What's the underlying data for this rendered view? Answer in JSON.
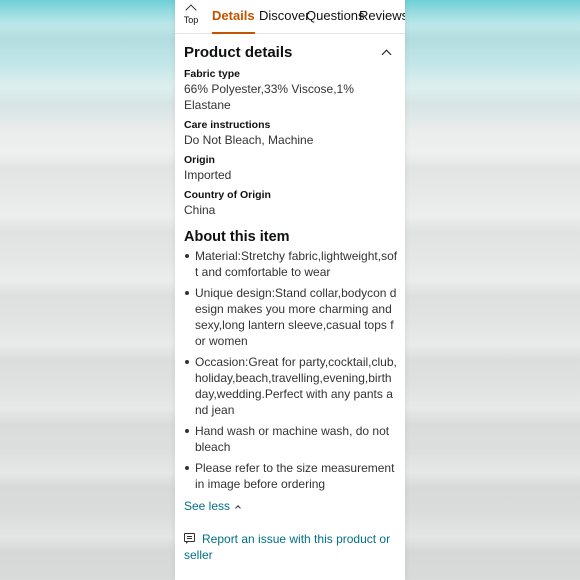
{
  "tabs": {
    "top_label": "Top",
    "details": "Details",
    "discover": "Discover",
    "questions": "Questions",
    "reviews": "Reviews"
  },
  "product_details": {
    "heading": "Product details",
    "items": [
      {
        "label": "Fabric type",
        "value": "66% Polyester,33% Viscose,1% Elastane"
      },
      {
        "label": "Care instructions",
        "value": "Do Not Bleach, Machine"
      },
      {
        "label": "Origin",
        "value": "Imported"
      },
      {
        "label": "Country of Origin",
        "value": "China"
      }
    ]
  },
  "about": {
    "heading": "About this item",
    "bullets": [
      "Material:Stretchy fabric,lightweight,soft and comfortable to wear",
      "Unique design:Stand collar,bodycon design makes you more charming and sexy,long lantern sleeve,casual tops for women",
      "Occasion:Great for party,cocktail,club,holiday,beach,travelling,evening,birthday,wedding.Perfect with any pants and jean",
      "Hand wash or machine wash, do not bleach",
      "Please refer to the size measurement in image before ordering"
    ],
    "see_less": "See less"
  },
  "report_link": "Report an issue with this product or seller",
  "colors": {
    "accent": "#c45500",
    "link": "#007185",
    "text": "#0f1111"
  }
}
